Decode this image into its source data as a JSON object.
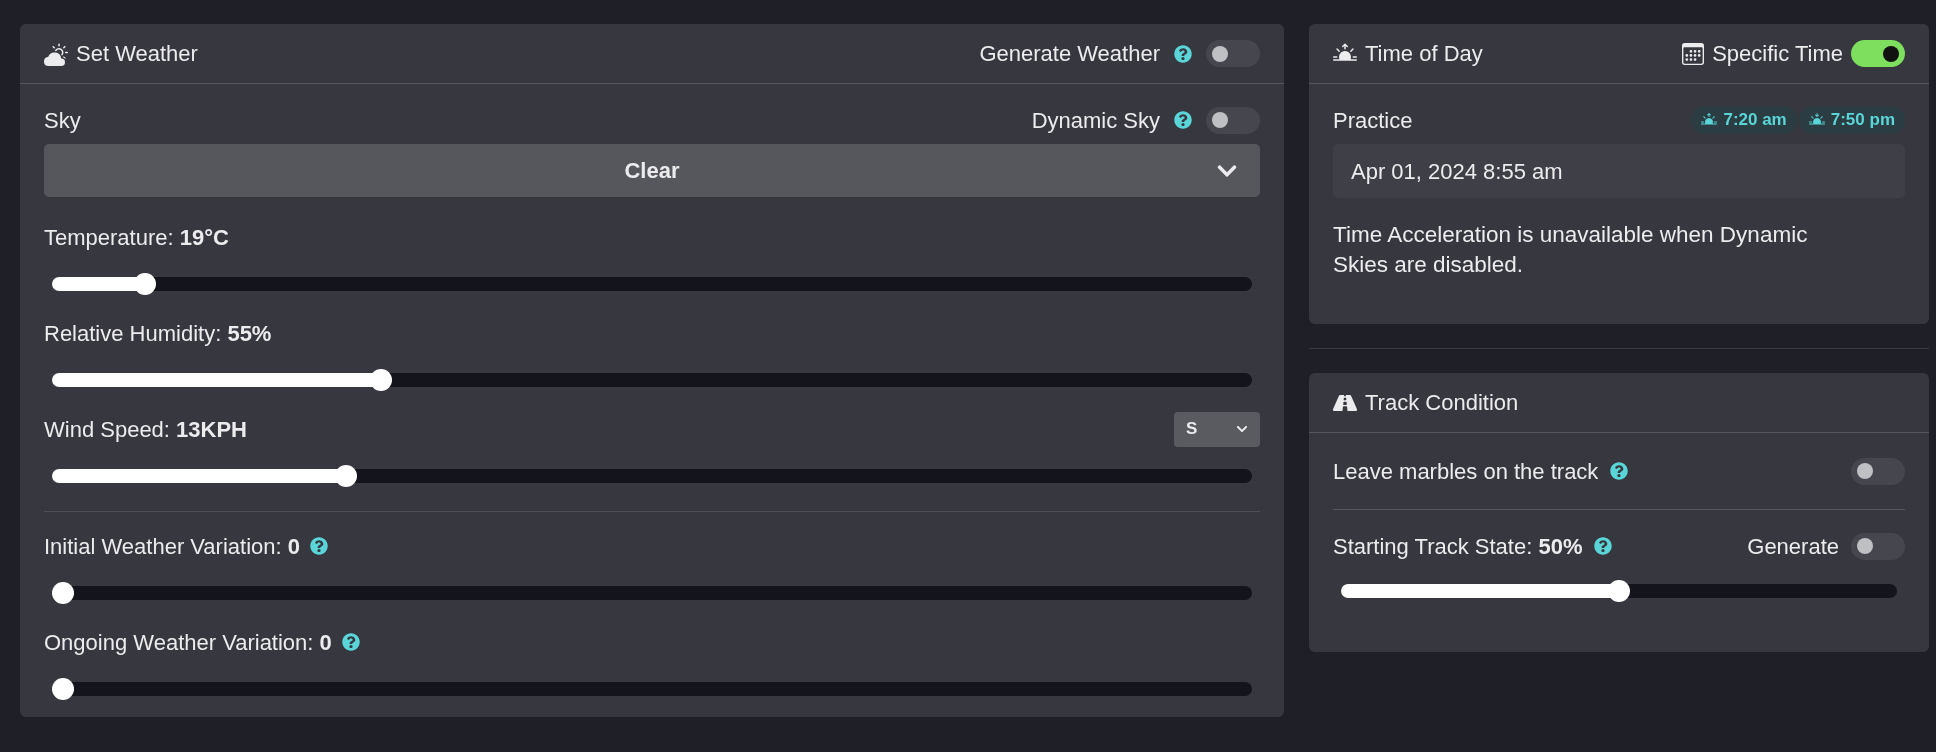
{
  "weather_panel": {
    "title": "Set Weather",
    "generate": {
      "label": "Generate Weather",
      "on": false
    },
    "sky": {
      "label": "Sky",
      "dynamic": {
        "label": "Dynamic Sky",
        "on": false
      },
      "value": "Clear"
    },
    "sliders": [
      {
        "label": "Temperature: **19°C**",
        "level": 0.07,
        "help": false
      },
      {
        "label": "Relative Humidity: **55%**",
        "level": 0.27,
        "help": false
      },
      {
        "label": "Wind Speed: **13KPH**",
        "level": 0.24,
        "help": false,
        "direction": "S"
      }
    ],
    "variation_sliders": [
      {
        "label": "Initial Weather Variation: **0**",
        "level": 0,
        "help": true
      },
      {
        "label": "Ongoing Weather Variation: **0**",
        "level": 0,
        "help": true
      }
    ]
  },
  "time_panel": {
    "title": "Time of Day",
    "specific_time": {
      "label": "Specific Time",
      "on": true
    },
    "session": "Practice",
    "sunrise": "7:20 am",
    "sunset": "7:50 pm",
    "datetime": "Apr 01, 2024 8:55 am",
    "note": "Time Acceleration is unavailable when Dynamic Skies are disabled."
  },
  "track_panel": {
    "title": "Track Condition",
    "marbles": {
      "label": "Leave marbles on the track",
      "on": false
    },
    "state": {
      "label": "Starting Track State: **50%**",
      "level": 0.5,
      "generate": {
        "label": "Generate",
        "on": false
      }
    }
  }
}
